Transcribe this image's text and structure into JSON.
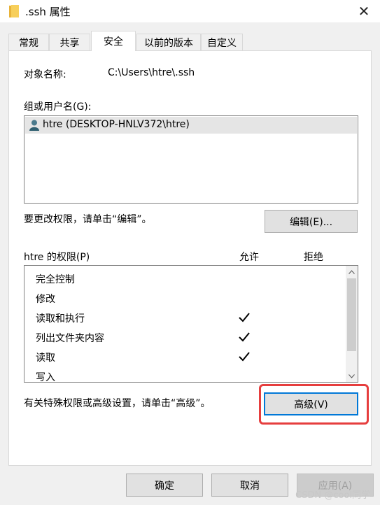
{
  "window": {
    "title": ".ssh 属性"
  },
  "tabs": [
    {
      "label": "常规"
    },
    {
      "label": "共享"
    },
    {
      "label": "安全"
    },
    {
      "label": "以前的版本"
    },
    {
      "label": "自定义"
    }
  ],
  "security": {
    "object_label": "对象名称:",
    "object_value": "C:\\Users\\htre\\.ssh",
    "group_label": "组或用户名(G):",
    "users": [
      {
        "name": "htre (DESKTOP-HNLV372\\htre)"
      }
    ],
    "edit_hint": "要更改权限，请单击“编辑”。",
    "edit_button": "编辑(E)...",
    "perm_header": "htre 的权限(P)",
    "allow_header": "允许",
    "deny_header": "拒绝",
    "permissions": [
      {
        "name": "完全控制",
        "allow": false
      },
      {
        "name": "修改",
        "allow": false
      },
      {
        "name": "读取和执行",
        "allow": true
      },
      {
        "name": "列出文件夹内容",
        "allow": true
      },
      {
        "name": "读取",
        "allow": true
      },
      {
        "name": "写入",
        "allow": false
      }
    ],
    "advanced_hint": "有关特殊权限或高级设置，请单击“高级”。",
    "advanced_button": "高级(V)"
  },
  "footer": {
    "ok": "确定",
    "cancel": "取消",
    "apply": "应用(A)"
  },
  "watermark": "CSDN @cool同学"
}
